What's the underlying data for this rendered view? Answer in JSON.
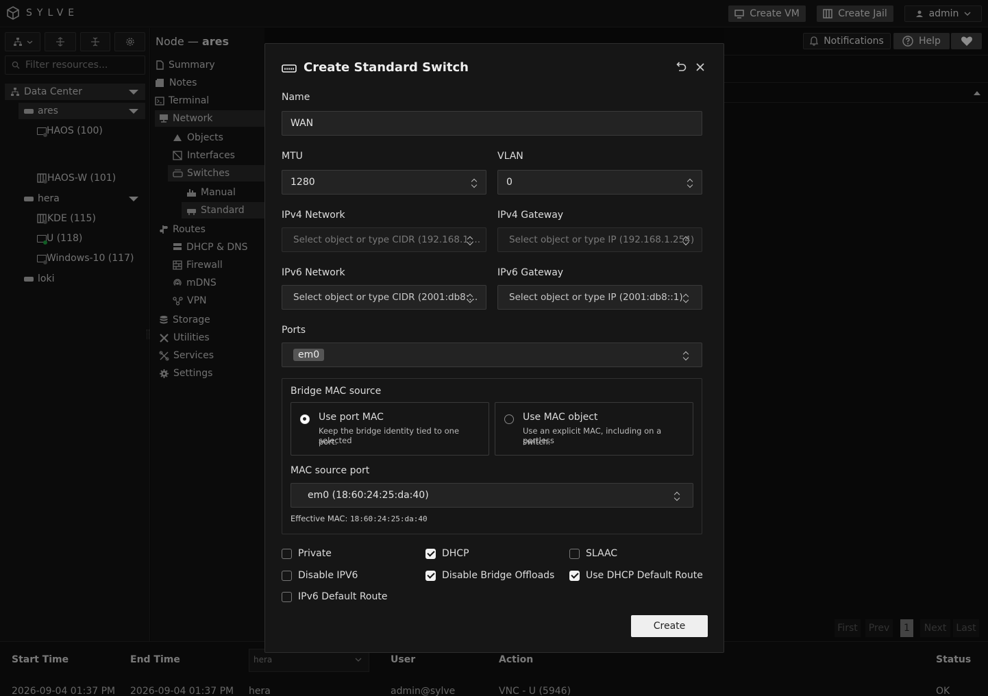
{
  "app": {
    "name": "SYLVE"
  },
  "topbar": {
    "create_vm": "Create VM",
    "create_jail": "Create Jail",
    "user": "admin"
  },
  "header": {
    "node_prefix": "Node —",
    "node_name": "ares",
    "notifications": "Notifications",
    "help": "Help"
  },
  "sidebar": {
    "filter_placeholder": "Filter resources...",
    "tree": {
      "datacenter": "Data Center",
      "ares": "ares",
      "haos": "HAOS (100)",
      "haosw": "HAOS-W (101)",
      "hera": "hera",
      "kde": "KDE (115)",
      "u": "U (118)",
      "win": "Windows-10 (117)",
      "loki": "loki"
    }
  },
  "nav": {
    "summary": "Summary",
    "notes": "Notes",
    "terminal": "Terminal",
    "network": "Network",
    "objects": "Objects",
    "interfaces": "Interfaces",
    "switches": "Switches",
    "manual": "Manual",
    "standard": "Standard",
    "routes": "Routes",
    "dhcp": "DHCP & DNS",
    "firewall": "Firewall",
    "mdns": "mDNS",
    "vpn": "VPN",
    "storage": "Storage",
    "utilities": "Utilities",
    "services": "Services",
    "settings": "Settings"
  },
  "pagination": {
    "first": "First",
    "prev": "Prev",
    "page": "1",
    "next": "Next",
    "last": "Last"
  },
  "bottom": {
    "headers": {
      "start": "Start Time",
      "end": "End Time",
      "node_filter": "hera",
      "user": "User",
      "action": "Action",
      "status": "Status"
    },
    "row": {
      "start": "2026-09-04 01:37 PM",
      "end": "2026-09-04 01:37 PM",
      "node": "hera",
      "user": "admin@sylve",
      "action": "VNC - U (5946)",
      "status": "OK"
    }
  },
  "modal": {
    "title": "Create Standard Switch",
    "name_label": "Name",
    "name_value": "WAN",
    "mtu_label": "MTU",
    "mtu_value": "1280",
    "vlan_label": "VLAN",
    "vlan_value": "0",
    "ipv4_net_label": "IPv4 Network",
    "ipv4_net_placeholder": "Select object or type CIDR (192.168.1....",
    "ipv4_gw_label": "IPv4 Gateway",
    "ipv4_gw_placeholder": "Select object or type IP (192.168.1.254)",
    "ipv6_net_label": "IPv6 Network",
    "ipv6_net_placeholder": "Select object or type CIDR (2001:db8:...",
    "ipv6_gw_label": "IPv6 Gateway",
    "ipv6_gw_placeholder": "Select object or type IP (2001:db8::1)",
    "ports_label": "Ports",
    "ports_chip": "em0",
    "mac_source_label": "Bridge MAC source",
    "opt_port_title": "Use port MAC",
    "opt_port_desc1": "Keep the bridge identity tied to one selected",
    "opt_port_desc2": "port.",
    "opt_obj_title": "Use MAC object",
    "opt_obj_desc1": "Use an explicit MAC, including on a portless",
    "opt_obj_desc2": "switch.",
    "mac_port_label": "MAC source port",
    "mac_port_value": "em0 (18:60:24:25:da:40)",
    "effective_label": "Effective MAC:",
    "effective_value": "18:60:24:25:da:40",
    "cb_private": "Private",
    "cb_dhcp": "DHCP",
    "cb_slaac": "SLAAC",
    "cb_disable_ipv6": "Disable IPV6",
    "cb_disable_offloads": "Disable Bridge Offloads",
    "cb_dhcp_route": "Use DHCP Default Route",
    "cb_ipv6_route": "IPv6 Default Route",
    "create_button": "Create"
  }
}
